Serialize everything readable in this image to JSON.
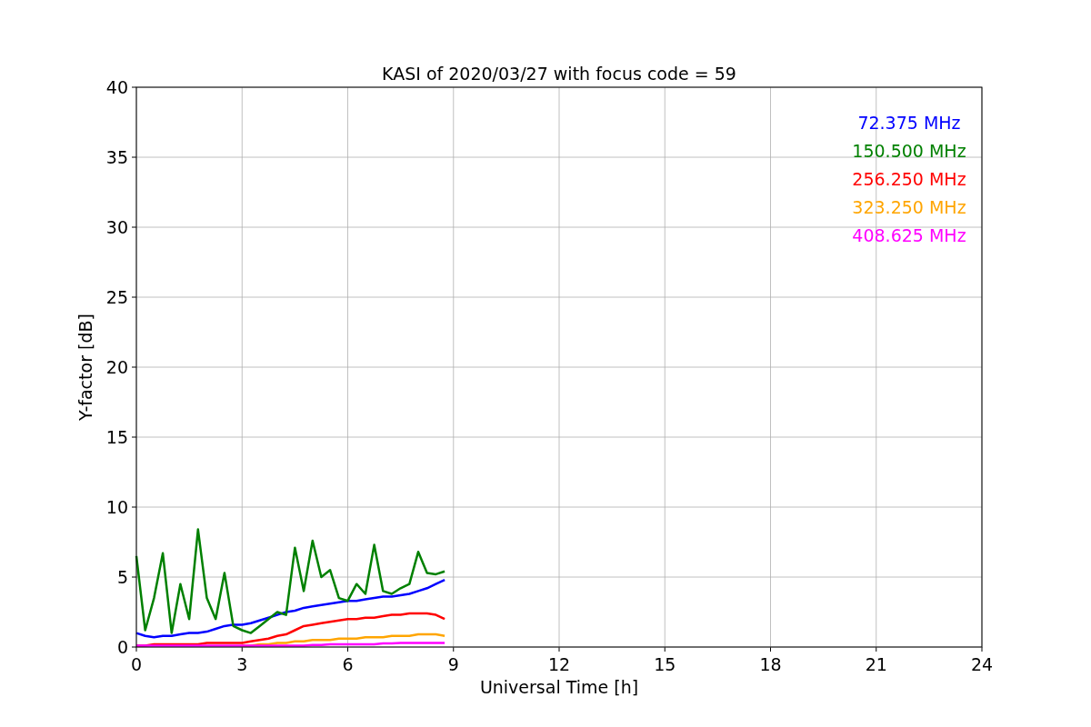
{
  "chart_data": {
    "type": "line",
    "title": "KASI of 2020/03/27 with focus code = 59",
    "xlabel": "Universal Time [h]",
    "ylabel": "Y-factor [dB]",
    "x": [
      0,
      0.25,
      0.5,
      0.75,
      1,
      1.25,
      1.5,
      1.75,
      2,
      2.25,
      2.5,
      2.75,
      3,
      3.25,
      3.5,
      3.75,
      4,
      4.25,
      4.5,
      4.75,
      5,
      5.25,
      5.5,
      5.75,
      6,
      6.25,
      6.5,
      6.75,
      7,
      7.25,
      7.5,
      7.75,
      8,
      8.25,
      8.5,
      8.75
    ],
    "series": [
      {
        "name": "72.375 MHz",
        "color": "#0000ff",
        "values": [
          1.0,
          0.8,
          0.7,
          0.8,
          0.8,
          0.9,
          1.0,
          1.0,
          1.1,
          1.3,
          1.5,
          1.6,
          1.6,
          1.7,
          1.9,
          2.1,
          2.3,
          2.5,
          2.6,
          2.8,
          2.9,
          3.0,
          3.1,
          3.2,
          3.3,
          3.3,
          3.4,
          3.5,
          3.6,
          3.6,
          3.7,
          3.8,
          4.0,
          4.2,
          4.5,
          4.8
        ]
      },
      {
        "name": "150.500 MHz",
        "color": "#008000",
        "values": [
          6.5,
          1.2,
          3.5,
          6.7,
          1.0,
          4.5,
          2.0,
          8.4,
          3.5,
          2.0,
          5.3,
          1.5,
          1.2,
          1.0,
          1.5,
          2.0,
          2.5,
          2.3,
          7.1,
          4.0,
          7.6,
          5.0,
          5.5,
          3.5,
          3.3,
          4.5,
          3.8,
          7.3,
          4.0,
          3.8,
          4.2,
          4.5,
          6.8,
          5.3,
          5.2,
          5.4
        ]
      },
      {
        "name": "256.250 MHz",
        "color": "#ff0000",
        "values": [
          0.1,
          0.1,
          0.2,
          0.2,
          0.2,
          0.2,
          0.2,
          0.2,
          0.3,
          0.3,
          0.3,
          0.3,
          0.3,
          0.4,
          0.5,
          0.6,
          0.8,
          0.9,
          1.2,
          1.5,
          1.6,
          1.7,
          1.8,
          1.9,
          2.0,
          2.0,
          2.1,
          2.1,
          2.2,
          2.3,
          2.3,
          2.4,
          2.4,
          2.4,
          2.3,
          2.0
        ]
      },
      {
        "name": "323.250 MHz",
        "color": "#ffa500",
        "values": [
          null,
          null,
          null,
          null,
          null,
          null,
          null,
          null,
          null,
          null,
          null,
          null,
          0.1,
          0.1,
          0.2,
          0.2,
          0.3,
          0.3,
          0.4,
          0.4,
          0.5,
          0.5,
          0.5,
          0.6,
          0.6,
          0.6,
          0.7,
          0.7,
          0.7,
          0.8,
          0.8,
          0.8,
          0.9,
          0.9,
          0.9,
          0.8
        ]
      },
      {
        "name": "408.625 MHz",
        "color": "#ff00ff",
        "values": [
          0.1,
          0.1,
          0.1,
          0.1,
          0.1,
          0.1,
          0.1,
          0.1,
          0.1,
          0.1,
          0.1,
          0.1,
          0.1,
          0.1,
          0.1,
          0.1,
          0.1,
          0.1,
          0.1,
          0.1,
          0.15,
          0.15,
          0.2,
          0.2,
          0.2,
          0.2,
          0.2,
          0.2,
          0.25,
          0.25,
          0.3,
          0.3,
          0.3,
          0.3,
          0.3,
          0.3
        ]
      }
    ],
    "grid": true,
    "xlim": [
      0,
      24
    ],
    "ylim": [
      0,
      40
    ],
    "xticks": [
      0,
      3,
      6,
      9,
      12,
      15,
      18,
      21,
      24
    ],
    "yticks": [
      0,
      5,
      10,
      15,
      20,
      25,
      30,
      35,
      40
    ]
  }
}
